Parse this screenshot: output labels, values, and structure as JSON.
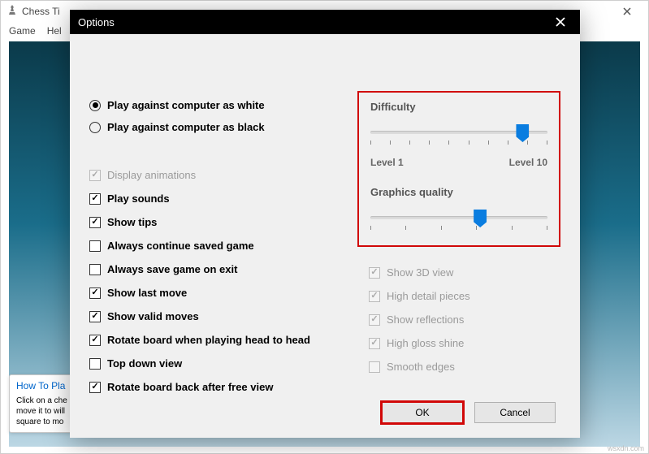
{
  "bgWindow": {
    "title": "Chess Ti",
    "menu": {
      "game": "Game",
      "help": "Hel"
    }
  },
  "helpTip": {
    "title": "How To Pla",
    "line1": "Click on a che",
    "line2": "move it to will",
    "line3": "square to mo"
  },
  "dialog": {
    "title": "Options",
    "radios": {
      "white": "Play against computer as white",
      "black": "Play against computer as black"
    },
    "checks": {
      "displayAnimations": "Display animations",
      "playSounds": "Play sounds",
      "showTips": "Show tips",
      "alwaysContinue": "Always continue saved game",
      "alwaysSave": "Always save game on exit",
      "showLast": "Show last move",
      "showValid": "Show valid moves",
      "rotateHead": "Rotate board when playing head to head",
      "topDown": "Top down view",
      "rotateFree": "Rotate board back after free view"
    },
    "difficulty": {
      "label": "Difficulty",
      "min": "Level 1",
      "max": "Level 10"
    },
    "graphics": {
      "label": "Graphics quality"
    },
    "gfxOpts": {
      "show3d": "Show 3D view",
      "highDetail": "High detail pieces",
      "reflections": "Show reflections",
      "gloss": "High gloss shine",
      "smooth": "Smooth edges"
    },
    "buttons": {
      "ok": "OK",
      "cancel": "Cancel"
    }
  },
  "footer": "wsxdn.com"
}
